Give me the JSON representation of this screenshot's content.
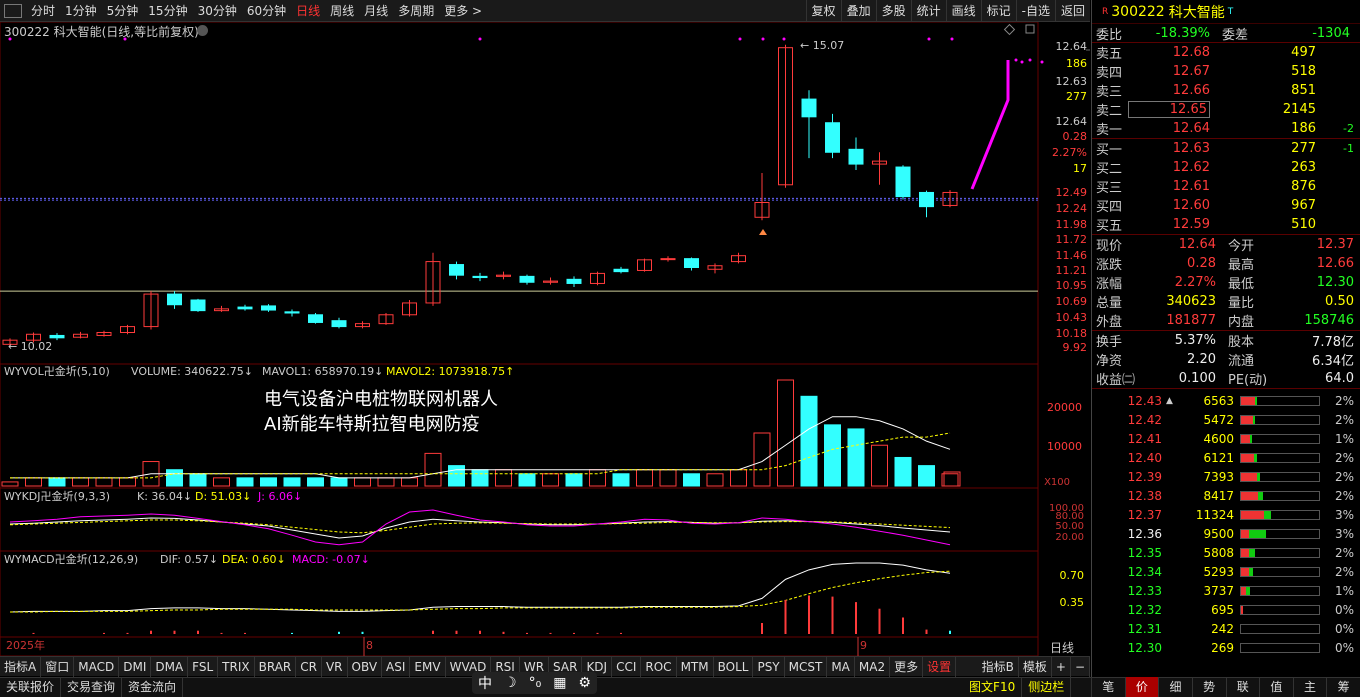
{
  "toolbar": {
    "periods": [
      "分时",
      "1分钟",
      "5分钟",
      "15分钟",
      "30分钟",
      "60分钟",
      "日线",
      "周线",
      "月线",
      "多周期",
      "更多 >"
    ],
    "active": "日线",
    "right": [
      "复权",
      "叠加",
      "多股",
      "统计",
      "画线",
      "标记",
      "-自选",
      "返回"
    ]
  },
  "chart": {
    "title": "300222 科大智能(日线,等比前复权)",
    "high_label": "15.07",
    "low_label": "10.02",
    "price_axis": [
      "12.64",
      "186",
      "12.63",
      "277",
      "12.64",
      "0.28",
      "2.27%",
      "17",
      "12.49",
      "12.24",
      "11.98",
      "11.72",
      "11.46",
      "11.21",
      "10.95",
      "10.69",
      "10.43",
      "10.18",
      "9.92"
    ],
    "vol_title": "WYVOL卍金圻(5,10)",
    "vol_value": "VOLUME: 340622.75",
    "mavol1": "MAVOL1: 658970.19",
    "mavol2": "MAVOL2: 1073918.75",
    "vol_axis": [
      "20000",
      "10000",
      "X100"
    ],
    "text1": "电气设备沪电桩物联网机器人",
    "text2": "AI新能车特斯拉智电网防疫",
    "kdj_title": "WYKDJ卍金圻(9,3,3)",
    "kdj_k": "K: 36.04",
    "kdj_d": "D: 51.03",
    "kdj_j": "J: 6.06",
    "kdj_axis": [
      "100.00",
      "80.00",
      "50.00",
      "20.00"
    ],
    "macd_title": "WYMACD卍金圻(12,26,9)",
    "macd_dif": "DIF: 0.57",
    "macd_dea": "DEA: 0.60",
    "macd_macd": "MACD: -0.07",
    "macd_axis": [
      "0.70",
      "0.35"
    ],
    "date_year": "2025年",
    "date_m1": "8",
    "date_m2": "9",
    "axis_mode": "日线"
  },
  "colors": {
    "up": "#ff3b3b",
    "down": "#33ffff",
    "ma": "#ffffff",
    "ma2": "#ffff00",
    "kdj_j": "#ff33ff"
  },
  "candles": [
    {
      "o": 10.05,
      "c": 10.12,
      "h": 10.15,
      "l": 10.02
    },
    {
      "o": 10.12,
      "c": 10.22,
      "h": 10.25,
      "l": 10.08
    },
    {
      "o": 10.2,
      "c": 10.16,
      "h": 10.24,
      "l": 10.12
    },
    {
      "o": 10.17,
      "c": 10.22,
      "h": 10.26,
      "l": 10.15
    },
    {
      "o": 10.2,
      "c": 10.25,
      "h": 10.28,
      "l": 10.18
    },
    {
      "o": 10.25,
      "c": 10.35,
      "h": 10.38,
      "l": 10.22
    },
    {
      "o": 10.35,
      "c": 10.9,
      "h": 10.95,
      "l": 10.3
    },
    {
      "o": 10.9,
      "c": 10.72,
      "h": 10.95,
      "l": 10.65
    },
    {
      "o": 10.8,
      "c": 10.62,
      "h": 10.82,
      "l": 10.6
    },
    {
      "o": 10.62,
      "c": 10.65,
      "h": 10.7,
      "l": 10.6
    },
    {
      "o": 10.68,
      "c": 10.65,
      "h": 10.72,
      "l": 10.62
    },
    {
      "o": 10.7,
      "c": 10.63,
      "h": 10.73,
      "l": 10.6
    },
    {
      "o": 10.6,
      "c": 10.58,
      "h": 10.64,
      "l": 10.52
    },
    {
      "o": 10.55,
      "c": 10.42,
      "h": 10.58,
      "l": 10.4
    },
    {
      "o": 10.45,
      "c": 10.35,
      "h": 10.5,
      "l": 10.32
    },
    {
      "o": 10.35,
      "c": 10.4,
      "h": 10.44,
      "l": 10.32
    },
    {
      "o": 10.4,
      "c": 10.55,
      "h": 10.58,
      "l": 10.38
    },
    {
      "o": 10.55,
      "c": 10.75,
      "h": 10.8,
      "l": 10.52
    },
    {
      "o": 10.75,
      "c": 11.45,
      "h": 11.6,
      "l": 10.7
    },
    {
      "o": 11.4,
      "c": 11.22,
      "h": 11.45,
      "l": 11.15
    },
    {
      "o": 11.2,
      "c": 11.18,
      "h": 11.26,
      "l": 11.12
    },
    {
      "o": 11.2,
      "c": 11.22,
      "h": 11.28,
      "l": 11.15
    },
    {
      "o": 11.2,
      "c": 11.1,
      "h": 11.23,
      "l": 11.06
    },
    {
      "o": 11.1,
      "c": 11.12,
      "h": 11.18,
      "l": 11.06
    },
    {
      "o": 11.15,
      "c": 11.08,
      "h": 11.2,
      "l": 11.02
    },
    {
      "o": 11.08,
      "c": 11.25,
      "h": 11.28,
      "l": 11.05
    },
    {
      "o": 11.32,
      "c": 11.28,
      "h": 11.36,
      "l": 11.25
    },
    {
      "o": 11.3,
      "c": 11.48,
      "h": 11.5,
      "l": 11.28
    },
    {
      "o": 11.5,
      "c": 11.5,
      "h": 11.54,
      "l": 11.45
    },
    {
      "o": 11.5,
      "c": 11.35,
      "h": 11.52,
      "l": 11.3
    },
    {
      "o": 11.32,
      "c": 11.38,
      "h": 11.42,
      "l": 11.25
    },
    {
      "o": 11.45,
      "c": 11.55,
      "h": 11.6,
      "l": 11.42
    },
    {
      "o": 12.2,
      "c": 12.45,
      "h": 12.95,
      "l": 12.15
    },
    {
      "o": 12.75,
      "c": 15.07,
      "h": 15.12,
      "l": 12.7
    },
    {
      "o": 14.2,
      "c": 13.9,
      "h": 14.35,
      "l": 13.2
    },
    {
      "o": 13.8,
      "c": 13.3,
      "h": 13.95,
      "l": 13.2
    },
    {
      "o": 13.35,
      "c": 13.1,
      "h": 13.55,
      "l": 13.0
    },
    {
      "o": 13.1,
      "c": 13.15,
      "h": 13.3,
      "l": 12.75
    },
    {
      "o": 13.05,
      "c": 12.55,
      "h": 13.08,
      "l": 12.5
    },
    {
      "o": 12.62,
      "c": 12.38,
      "h": 12.65,
      "l": 12.2
    },
    {
      "o": 12.4,
      "c": 12.62,
      "h": 12.66,
      "l": 12.37
    }
  ],
  "volumes": [
    1,
    2,
    2,
    2,
    2,
    2,
    6,
    4,
    3,
    2,
    2,
    2,
    2,
    2,
    2,
    2,
    2,
    2,
    8,
    5,
    4,
    4,
    3,
    3,
    3,
    4,
    3,
    4,
    4,
    3,
    3,
    4,
    13,
    26,
    22,
    15,
    14,
    10,
    7,
    5,
    3
  ],
  "quote": {
    "code": "300222",
    "name": "科大智能",
    "sup_r": "R",
    "sup_t": "T",
    "wb_label": "委比",
    "wb": "-18.39%",
    "wc_label": "委差",
    "wc": "-1304",
    "sell": [
      {
        "l": "卖五",
        "p": "12.68",
        "v": "497",
        "d": ""
      },
      {
        "l": "卖四",
        "p": "12.67",
        "v": "518",
        "d": ""
      },
      {
        "l": "卖三",
        "p": "12.66",
        "v": "851",
        "d": ""
      },
      {
        "l": "卖二",
        "p": "12.65",
        "v": "2145",
        "d": ""
      },
      {
        "l": "卖一",
        "p": "12.64",
        "v": "186",
        "d": "-2"
      }
    ],
    "buy": [
      {
        "l": "买一",
        "p": "12.63",
        "v": "277",
        "d": "-1"
      },
      {
        "l": "买二",
        "p": "12.62",
        "v": "263",
        "d": ""
      },
      {
        "l": "买三",
        "p": "12.61",
        "v": "876",
        "d": ""
      },
      {
        "l": "买四",
        "p": "12.60",
        "v": "967",
        "d": ""
      },
      {
        "l": "买五",
        "p": "12.59",
        "v": "510",
        "d": ""
      }
    ],
    "fields": [
      [
        {
          "l": "现价",
          "v": "12.64",
          "c": "red"
        },
        {
          "l": "今开",
          "v": "12.37",
          "c": "red"
        }
      ],
      [
        {
          "l": "涨跌",
          "v": "0.28",
          "c": "red"
        },
        {
          "l": "最高",
          "v": "12.66",
          "c": "red"
        }
      ],
      [
        {
          "l": "涨幅",
          "v": "2.27%",
          "c": "red"
        },
        {
          "l": "最低",
          "v": "12.30",
          "c": "green"
        }
      ],
      [
        {
          "l": "总量",
          "v": "340623",
          "c": "yellow"
        },
        {
          "l": "量比",
          "v": "0.50",
          "c": "yellow"
        }
      ],
      [
        {
          "l": "外盘",
          "v": "181877",
          "c": "red"
        },
        {
          "l": "内盘",
          "v": "158746",
          "c": "green"
        }
      ]
    ],
    "fields2": [
      [
        {
          "l": "换手",
          "v": "5.37%",
          "c": "white"
        },
        {
          "l": "股本",
          "v": "7.78亿",
          "c": "white"
        }
      ],
      [
        {
          "l": "净资",
          "v": "2.20",
          "c": "white"
        },
        {
          "l": "流通",
          "v": "6.34亿",
          "c": "white"
        }
      ],
      [
        {
          "l": "收益㈡",
          "v": "0.100",
          "c": "white"
        },
        {
          "l": "PE(动)",
          "v": "64.0",
          "c": "white"
        }
      ]
    ],
    "deals": [
      {
        "p": "12.43",
        "v": "6563",
        "pct": "2%",
        "c": "red",
        "r": 0.18,
        "g": 0.03,
        "mark": "▲"
      },
      {
        "p": "12.42",
        "v": "5472",
        "pct": "2%",
        "c": "red",
        "r": 0.15,
        "g": 0.03,
        "mark": ""
      },
      {
        "p": "12.41",
        "v": "4600",
        "pct": "1%",
        "c": "red",
        "r": 0.12,
        "g": 0.02,
        "mark": ""
      },
      {
        "p": "12.40",
        "v": "6121",
        "pct": "2%",
        "c": "red",
        "r": 0.17,
        "g": 0.03,
        "mark": ""
      },
      {
        "p": "12.39",
        "v": "7393",
        "pct": "2%",
        "c": "red",
        "r": 0.2,
        "g": 0.05,
        "mark": ""
      },
      {
        "p": "12.38",
        "v": "8417",
        "pct": "2%",
        "c": "red",
        "r": 0.22,
        "g": 0.06,
        "mark": ""
      },
      {
        "p": "12.37",
        "v": "11324",
        "pct": "3%",
        "c": "red",
        "r": 0.3,
        "g": 0.08,
        "mark": ""
      },
      {
        "p": "12.36",
        "v": "9500",
        "pct": "3%",
        "c": "white",
        "r": 0.1,
        "g": 0.22,
        "mark": ""
      },
      {
        "p": "12.35",
        "v": "5808",
        "pct": "2%",
        "c": "green",
        "r": 0.1,
        "g": 0.08,
        "mark": ""
      },
      {
        "p": "12.34",
        "v": "5293",
        "pct": "2%",
        "c": "green",
        "r": 0.1,
        "g": 0.06,
        "mark": ""
      },
      {
        "p": "12.33",
        "v": "3737",
        "pct": "1%",
        "c": "green",
        "r": 0.06,
        "g": 0.05,
        "mark": ""
      },
      {
        "p": "12.32",
        "v": "695",
        "pct": "0%",
        "c": "green",
        "r": 0.02,
        "g": 0.0,
        "mark": ""
      },
      {
        "p": "12.31",
        "v": "242",
        "pct": "0%",
        "c": "green",
        "r": 0.0,
        "g": 0.0,
        "mark": ""
      },
      {
        "p": "12.30",
        "v": "269",
        "pct": "0%",
        "c": "green",
        "r": 0.0,
        "g": 0.0,
        "mark": ""
      }
    ]
  },
  "bottom": {
    "items": [
      "指标A",
      "窗口",
      "MACD",
      "DMI",
      "DMA",
      "FSL",
      "TRIX",
      "BRAR",
      "CR",
      "VR",
      "OBV",
      "ASI",
      "EMV",
      "WVAD",
      "RSI",
      "WR",
      "SAR",
      "KDJ",
      "CCI",
      "ROC",
      "MTM",
      "BOLL",
      "PSY",
      "MCST",
      "MA",
      "MA2",
      "更多",
      "设置"
    ],
    "right": [
      "指标B",
      "模板",
      "+",
      "−"
    ]
  },
  "status": {
    "items": [
      "关联报价",
      "交易查询",
      "资金流向"
    ],
    "right": [
      "图文F10",
      "侧边栏"
    ]
  },
  "qtabs": [
    "笔",
    "价",
    "细",
    "势",
    "联",
    "值",
    "主",
    "筹"
  ],
  "tools": [
    "中",
    "☽",
    "°₀",
    "▦",
    "⚙"
  ]
}
